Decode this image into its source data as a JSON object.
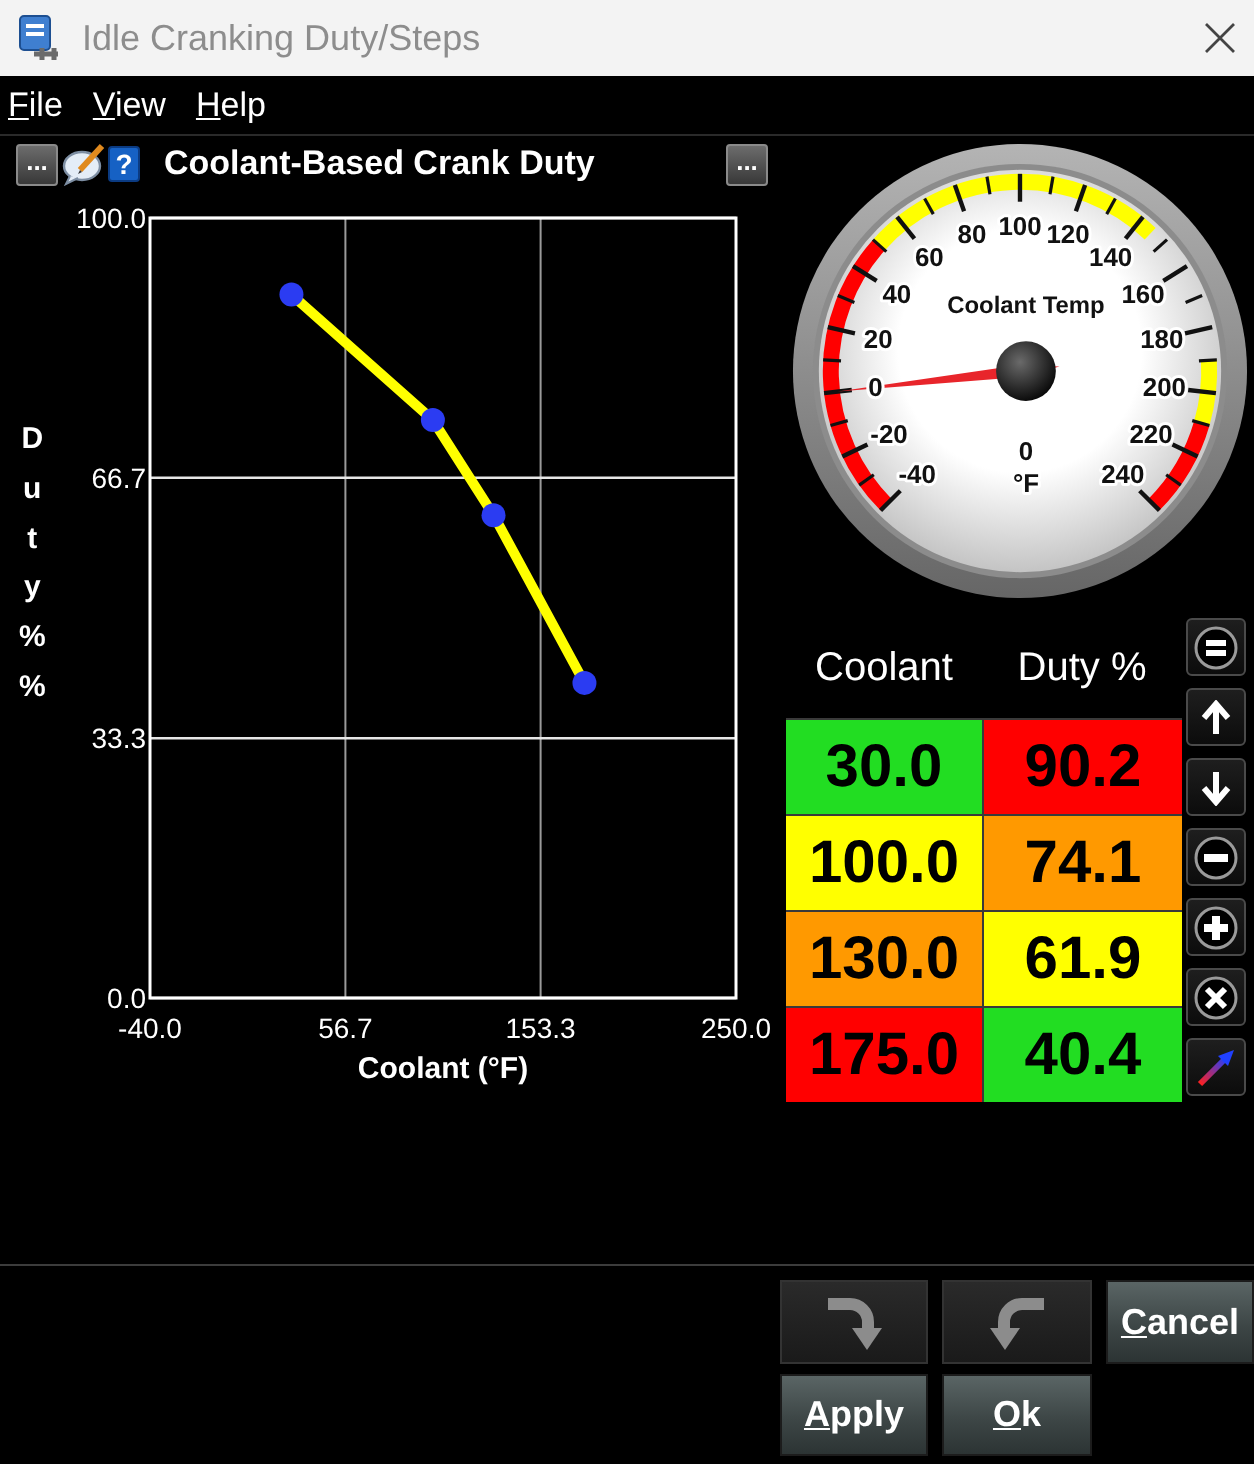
{
  "window": {
    "title": "Idle Cranking Duty/Steps"
  },
  "menu": [
    "File",
    "View",
    "Help"
  ],
  "header": {
    "left_button": "...",
    "help_button": "?",
    "title": "Coolant-Based Crank Duty",
    "right_button": "..."
  },
  "chart": {
    "chart_data": {
      "type": "line",
      "xlabel": "Coolant (°F)",
      "ylabel": "Duty % %",
      "x": [
        30,
        100,
        130,
        175
      ],
      "series": [
        {
          "color": "#ffff00",
          "marker": true,
          "values": [
            90.2,
            74.1,
            61.9,
            40.4
          ]
        }
      ],
      "xlim": [
        -40,
        250
      ],
      "ylim": [
        0,
        100
      ],
      "xticks": [
        {
          "value": -40,
          "label": "-40.0"
        },
        {
          "value": 56.7,
          "label": "56.7"
        },
        {
          "value": 153.3,
          "label": "153.3"
        },
        {
          "value": 250,
          "label": "250.0"
        }
      ],
      "yticks": [
        {
          "value": 0,
          "label": "0.0"
        },
        {
          "value": 33.3,
          "label": "33.3"
        },
        {
          "value": 66.7,
          "label": "66.7"
        },
        {
          "value": 100,
          "label": "100.0"
        }
      ],
      "grid": true
    }
  },
  "gauge": {
    "scale_labels": [
      "100",
      "80",
      "120",
      "60",
      "140",
      "40",
      "160",
      "20",
      "180",
      "0",
      "200",
      "-20",
      "220",
      "-40",
      "240"
    ],
    "title": "Coolant Temp",
    "reading": "0",
    "unit": "°F"
  },
  "table": {
    "columns": [
      "Coolant",
      "Duty %"
    ],
    "rows": [
      {
        "cells": [
          {
            "value": "30.0",
            "color": "#22dd22"
          },
          {
            "value": "90.2",
            "color": "#ff0000"
          }
        ]
      },
      {
        "cells": [
          {
            "value": "100.0",
            "color": "#ffff00"
          },
          {
            "value": "74.1",
            "color": "#ff9900"
          }
        ]
      },
      {
        "cells": [
          {
            "value": "130.0",
            "color": "#ff9900"
          },
          {
            "value": "61.9",
            "color": "#ffff00"
          }
        ]
      },
      {
        "cells": [
          {
            "value": "175.0",
            "color": "#ff0000"
          },
          {
            "value": "40.4",
            "color": "#22dd22"
          }
        ]
      }
    ]
  },
  "buttons": [
    {
      "kind": "undo",
      "disabled": true
    },
    {
      "kind": "redo",
      "disabled": true
    },
    {
      "kind": "text",
      "label": "Cancel",
      "disabled": false
    },
    {
      "kind": "text",
      "label": "Apply",
      "disabled": false
    },
    {
      "kind": "text",
      "label": "Ok",
      "disabled": false
    }
  ]
}
